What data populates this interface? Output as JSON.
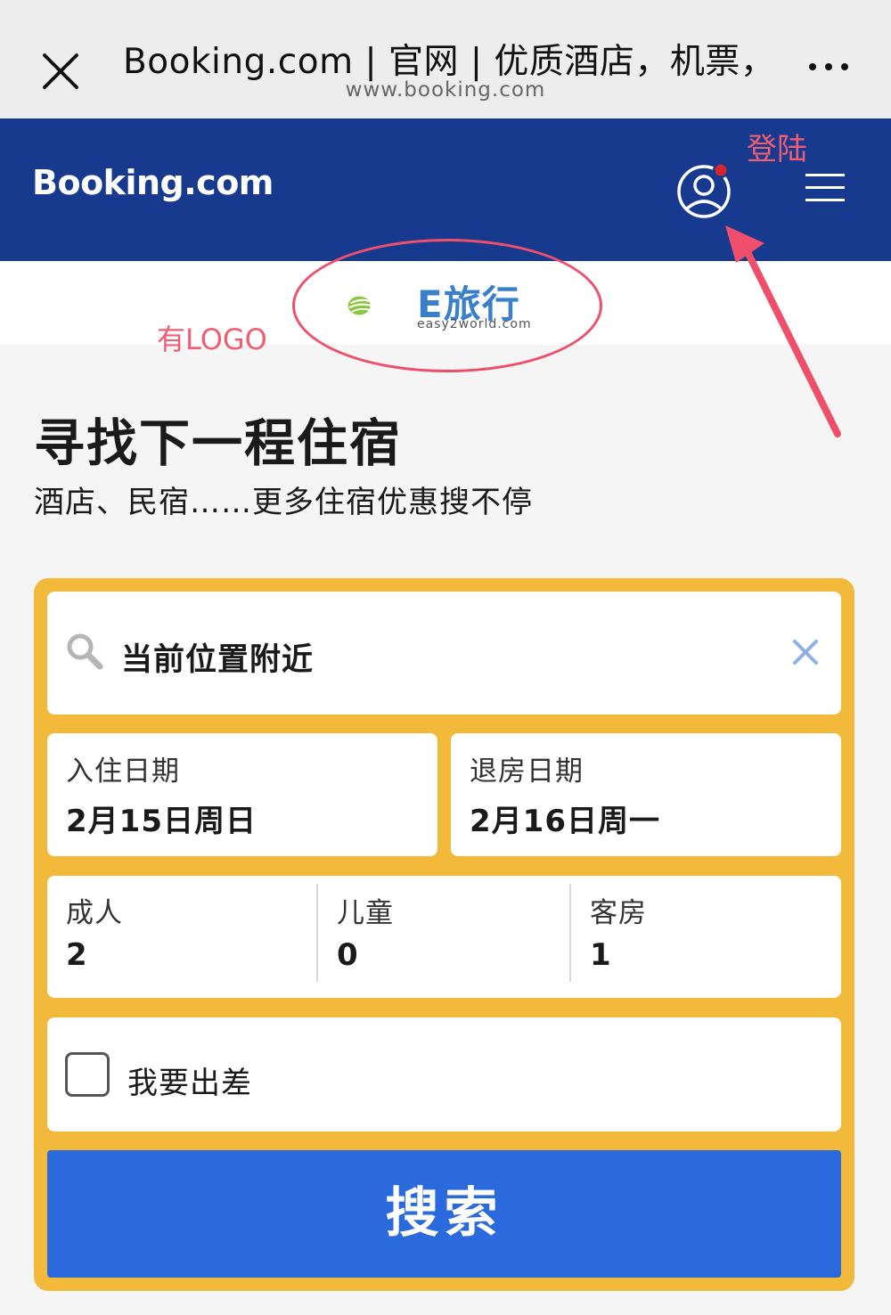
{
  "browser": {
    "title": "Booking.com | 官网 | 优质酒店，机票，",
    "url": "www.booking.com"
  },
  "header": {
    "brand": "Booking.com",
    "icons": [
      "account-icon",
      "hamburger-menu-icon"
    ],
    "bg_color": "#173a8f"
  },
  "partner_logo": {
    "name": "E旅行",
    "sub": "easy2world.com"
  },
  "annotations": {
    "logo_note": "有LOGO",
    "login_note": "登陆",
    "color": "#ef4f6b"
  },
  "hero": {
    "title": "寻找下一程住宿",
    "subtitle": "酒店、民宿……更多住宿优惠搜不停"
  },
  "search_form": {
    "destination": "当前位置附近",
    "checkin": {
      "label": "入住日期",
      "value": "2月15日周日"
    },
    "checkout": {
      "label": "退房日期",
      "value": "2月16日周一"
    },
    "adults": {
      "label": "成人",
      "value": "2"
    },
    "children": {
      "label": "儿童",
      "value": "0"
    },
    "rooms": {
      "label": "客房",
      "value": "1"
    },
    "business_trip": {
      "label": "我要出差",
      "checked": false
    },
    "search_button": "搜索",
    "accent_color": "#f3b93b",
    "button_color": "#2a6adc"
  }
}
